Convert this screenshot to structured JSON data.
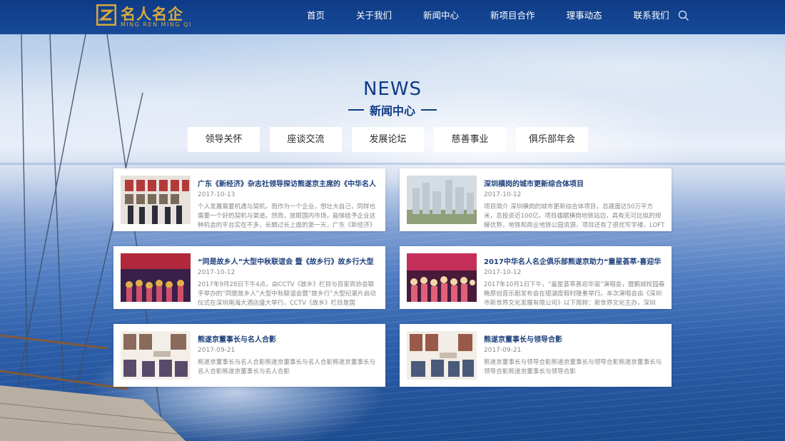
{
  "logo": {
    "cn": "名人名企",
    "en": "MING REN MING QI"
  },
  "nav": {
    "items": [
      "首页",
      "关于我们",
      "新闻中心",
      "新项目合作",
      "理事动态",
      "联系我们"
    ]
  },
  "section": {
    "title_en": "NEWS",
    "title_cn": "新闻中心"
  },
  "categories": [
    "领导关怀",
    "座谈交流",
    "发展论坛",
    "慈善事业",
    "俱乐部年会"
  ],
  "news": [
    {
      "title": "广东《新经济》杂志社领导探访熊遂京主席的《中华名人",
      "date": "2017-10-13",
      "desc": "个人发展需要机遇与契机，而作为一个企业，想壮大自己，同样也需要一个好的契机与渠道。然而，放眼国内市场，能够给予企业这种机会的平台实在不多，长期过长上面的第一天，广东《新经济》杂志社"
    },
    {
      "title": "深圳横岗的城市更新综合体项目",
      "date": "2017-10-12",
      "desc": "项目简介 深圳横岗的城市更新综合体项目，总建面达50万平方米，总投资近100亿。项目雄踞横岗地铁站边，具有无可比拟的规模优势，地铁和商业地铁公园资源，项目还有了很优写字楼，LOFT公"
    },
    {
      "title": "“同是故乡人”大型中秋联谊会 暨《故乡行》故乡行大型",
      "date": "2017-10-12",
      "desc": "2017年9月28日下午4点，由CCTV《故乡》栏目与百家商协会联手举办的“同是故乡人”大型中秋联谊会暨“故乡行”大型纪录片启动仪式在深圳南海大酒店盛大举行。CCTV《故乡》栏目是国"
    },
    {
      "title": "2017中华名人名企俱乐部熊遂京助力“童星荟萃·喜迎华",
      "date": "2017-10-12",
      "desc": "2017年10月1日下午，“童星荟萃喜迎华诞”演唱会，暨鹏城校园春晚原创音乐剧发布会在银湖度假村隆重举行。本次演唱会由《深圳市新世界文化发展有限公司》以下简称：新世界文化主办，深圳"
    },
    {
      "title": "熊遂京董事长与名人合影",
      "date": "2017-09-21",
      "desc": "熊遂京董事长与名人合影熊遂京董事长与名人合影熊遂京董事长与名人合影熊遂京董事长与名人合影"
    },
    {
      "title": "熊遂京董事长与领导合影",
      "date": "2017-09-21",
      "desc": "熊遂京董事长与领导合影熊遂京董事长与领导合影熊遂京董事长与领导合影熊遂京董事长与领导合影"
    }
  ],
  "colors": {
    "header": "#0e3b86",
    "logo_gold": "#d8a93e",
    "title_blue": "#0e3b86",
    "card_title": "#1c3f7c"
  }
}
